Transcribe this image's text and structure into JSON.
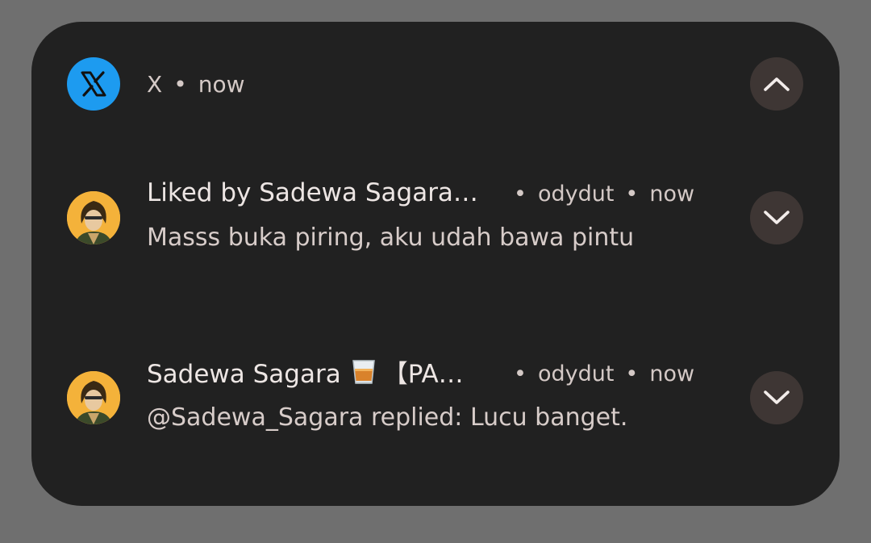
{
  "header": {
    "app_name": "X",
    "separator": "•",
    "time": "now",
    "collapse_icon": "chevron-up-icon"
  },
  "notifications": [
    {
      "title": "Liked by Sadewa Sagara…",
      "account": "odydut",
      "separator": "•",
      "time": "now",
      "body": "Masss buka piring, aku udah bawa pintu",
      "expand_icon": "chevron-down-icon"
    },
    {
      "title_name": "Sadewa Sagara",
      "title_emoji": "🥃",
      "title_rest": "【PA…",
      "account": "odydut",
      "separator": "•",
      "time": "now",
      "body": "@Sadewa_Sagara replied: Lucu banget.",
      "expand_icon": "chevron-down-icon"
    }
  ],
  "colors": {
    "background": "#6f6f6f",
    "card": "#212121",
    "x_brand": "#1d9bf0",
    "button": "#3e3634",
    "avatar": "#f4b23a"
  }
}
